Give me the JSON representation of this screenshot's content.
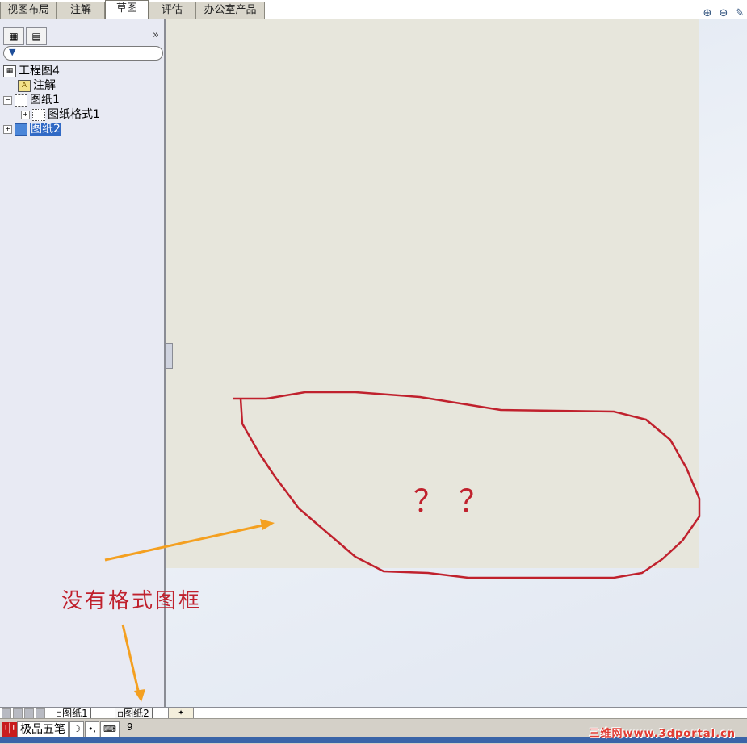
{
  "top_tabs": [
    "视图布局",
    "注解",
    "草图",
    "评估",
    "办公室产品"
  ],
  "active_tab": "草图",
  "view_toolbar": [
    "zoom-to-fit-icon",
    "zoom-area-icon",
    "sketch-tool-icon"
  ],
  "panel": {
    "tabs": [
      "feature-manager-icon",
      "property-manager-icon"
    ],
    "collapse_label": "»",
    "tree": {
      "root": "工程图4",
      "annotations": "注解",
      "sheet1": "图纸1",
      "sheet_format1": "图纸格式1",
      "sheet2": "图纸2"
    }
  },
  "annotations": {
    "no_format_text": "没有格式图框",
    "question_marks": "？？"
  },
  "sheet_tabs": [
    "图纸1",
    "图纸2"
  ],
  "active_sheet": "图纸2",
  "ime": {
    "name": "极品五笔",
    "logo": "中",
    "moon": "☽",
    "punct": "•,",
    "kbd": "⌨"
  },
  "status_value": "9",
  "watermark": "三维网www.3dportal.cn",
  "colors": {
    "annotation_red": "#c0212d",
    "annotation_orange": "#f4a020",
    "sheet_bg": "#e7e6dc",
    "selection_blue": "#316ac5"
  }
}
